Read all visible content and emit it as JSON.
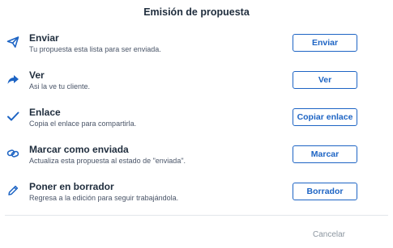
{
  "dialog": {
    "title": "Emisión de propuesta",
    "cancel_label": "Cancelar"
  },
  "accent_color": "#1d64c4",
  "options": [
    {
      "icon": "send-icon",
      "title": "Enviar",
      "description": "Tu propuesta esta lista para ser enviada.",
      "button": "Enviar"
    },
    {
      "icon": "share-arrow-icon",
      "title": "Ver",
      "description": "Asi la ve tu cliente.",
      "button": "Ver"
    },
    {
      "icon": "check-icon",
      "title": "Enlace",
      "description": "Copia el enlace para compartirla.",
      "button": "Copiar enlace"
    },
    {
      "icon": "link-icon",
      "title": "Marcar como enviada",
      "description": "Actualiza esta propuesta al estado de \"enviada\".",
      "button": "Marcar"
    },
    {
      "icon": "pencil-icon",
      "title": "Poner en borrador",
      "description": "Regresa a la edición para seguir trabajándola.",
      "button": "Borrador"
    }
  ]
}
